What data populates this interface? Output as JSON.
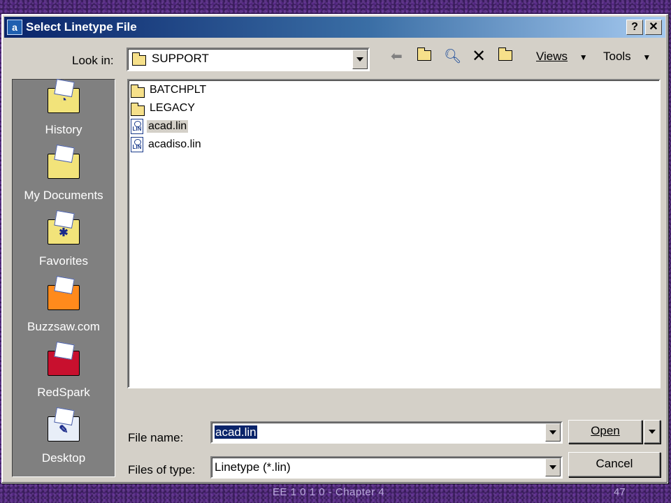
{
  "window": {
    "title": "Select Linetype File",
    "help_label": "?",
    "close_label": "✕"
  },
  "toolbar": {
    "look_in_label": "Look in:",
    "look_in_value": "SUPPORT",
    "back_icon": "back-arrow-icon",
    "up_icon": "up-folder-icon",
    "search_icon": "search-web-icon",
    "delete_icon": "delete-icon",
    "new_folder_icon": "new-folder-icon",
    "views_label": "Views",
    "tools_label": "Tools"
  },
  "places": [
    {
      "label": "History",
      "color": "#f2e37a",
      "icon": "history-icon",
      "glyph": "◔"
    },
    {
      "label": "My Documents",
      "color": "#f2e37a",
      "icon": "my-documents-icon",
      "glyph": ""
    },
    {
      "label": "Favorites",
      "color": "#f2e37a",
      "icon": "favorites-icon",
      "glyph": "✱"
    },
    {
      "label": "Buzzsaw.com",
      "color": "#ff8a1c",
      "icon": "buzzsaw-icon",
      "glyph": ""
    },
    {
      "label": "RedSpark",
      "color": "#c8102e",
      "icon": "redspark-icon",
      "glyph": ""
    },
    {
      "label": "Desktop",
      "color": "#e8eef8",
      "icon": "desktop-icon",
      "glyph": "✎"
    }
  ],
  "files": [
    {
      "name": "BATCHPLT",
      "type": "folder"
    },
    {
      "name": "LEGACY",
      "type": "folder"
    },
    {
      "name": "acad.lin",
      "type": "lin",
      "selected": true
    },
    {
      "name": "acadiso.lin",
      "type": "lin"
    }
  ],
  "lin_icon_text": "LIN",
  "form": {
    "file_name_label": "File name:",
    "file_name_value": "acad.lin",
    "files_of_type_label": "Files of type:",
    "files_of_type_value": "Linetype (*.lin)",
    "open_label": "Open",
    "cancel_label": "Cancel"
  },
  "footer": {
    "text": "EE 1 0 1 0 - Chapter 4",
    "page": "47"
  }
}
